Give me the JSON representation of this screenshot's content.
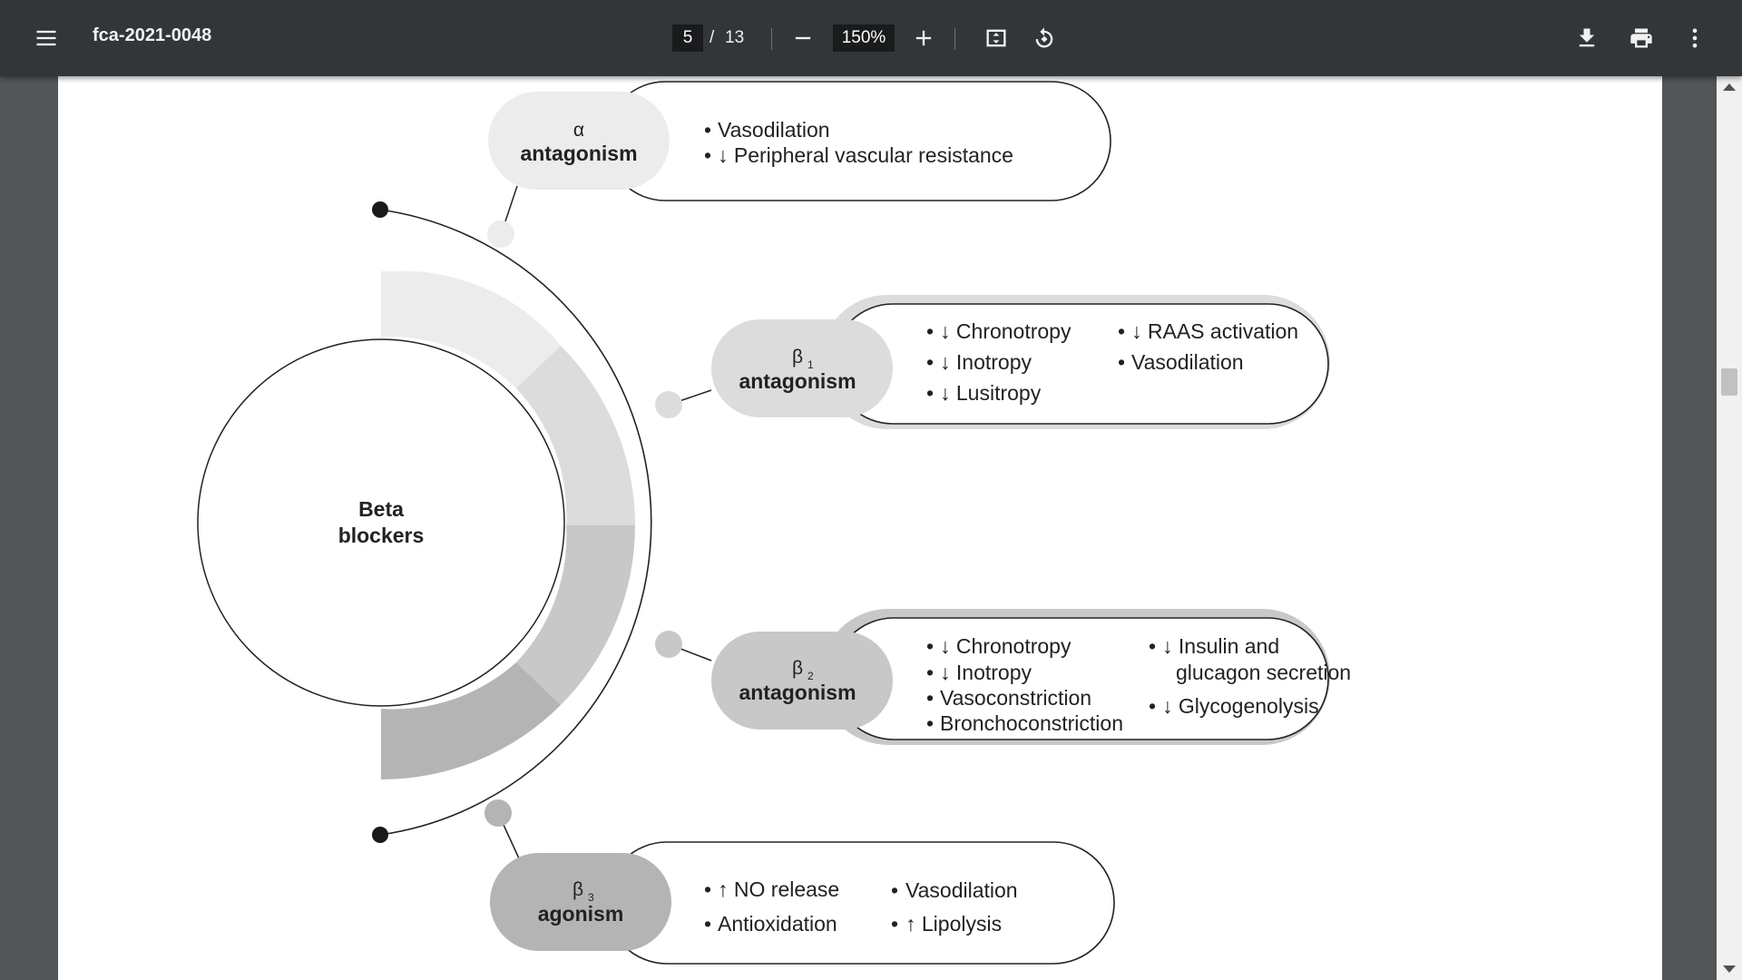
{
  "toolbar": {
    "title": "fca-2021-0048",
    "current_page": "5",
    "page_separator": "/",
    "total_pages": "13",
    "zoom": "150%",
    "icons": [
      "menu-icon",
      "zoom-out-icon",
      "zoom-in-icon",
      "fit-page-icon",
      "rotate-icon",
      "download-icon",
      "print-icon",
      "more-icon"
    ]
  },
  "diagram": {
    "center": {
      "line1": "Beta",
      "line2": "blockers"
    },
    "nodes": [
      {
        "symbol": "α",
        "subscript": "",
        "label": "antagonism",
        "pill_color": "#ececec",
        "col1": [
          "Vasodilation",
          "↓ Peripheral vascular resistance"
        ],
        "col2": []
      },
      {
        "symbol": "β",
        "subscript": "1",
        "label": "antagonism",
        "pill_color": "#dcdcdc",
        "col1": [
          "↓ Chronotropy",
          "↓ Inotropy",
          "↓ Lusitropy"
        ],
        "col2": [
          "↓ RAAS activation",
          "Vasodilation"
        ]
      },
      {
        "symbol": "β",
        "subscript": "2",
        "label": "antagonism",
        "pill_color": "#c8c8c8",
        "col1": [
          "↓ Chronotropy",
          "↓ Inotropy",
          "Vasoconstriction",
          "Bronchoconstriction"
        ],
        "col2": [
          "↓ Insulin and",
          "glucagon secretion",
          "↓ Glycogenolysis"
        ]
      },
      {
        "symbol": "β",
        "subscript": "3",
        "label": "agonism",
        "pill_color": "#b4b4b4",
        "col1": [
          "↑ NO release",
          "Antioxidation"
        ],
        "col2": [
          "Vasodilation",
          "↑ Lipolysis"
        ]
      }
    ]
  }
}
